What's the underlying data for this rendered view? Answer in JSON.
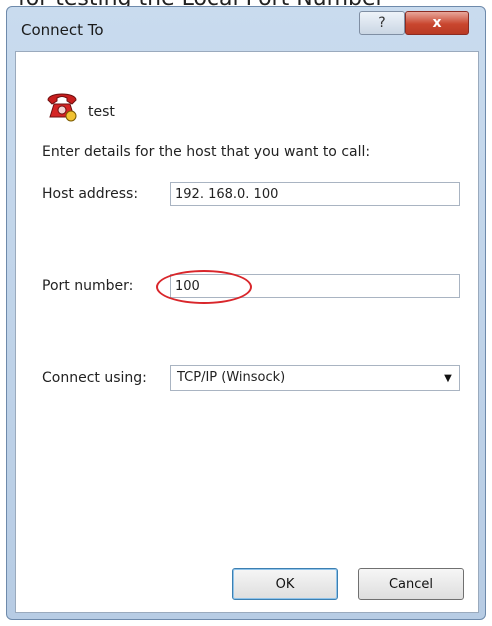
{
  "window": {
    "title": "Connect To",
    "help_label": "?",
    "close_label": "x"
  },
  "connection": {
    "name": "test",
    "icon": "phone-icon"
  },
  "instructions": "Enter details for the host that you want to call:",
  "form": {
    "host_label": "Host address:",
    "host_value": "192. 168.0. 100",
    "port_label": "Port number:",
    "port_value": "100",
    "connect_label": "Connect using:",
    "connect_value": "TCP/IP (Winsock)"
  },
  "buttons": {
    "ok": "OK",
    "cancel": "Cancel"
  },
  "annotation": {
    "color": "#d9262b"
  }
}
